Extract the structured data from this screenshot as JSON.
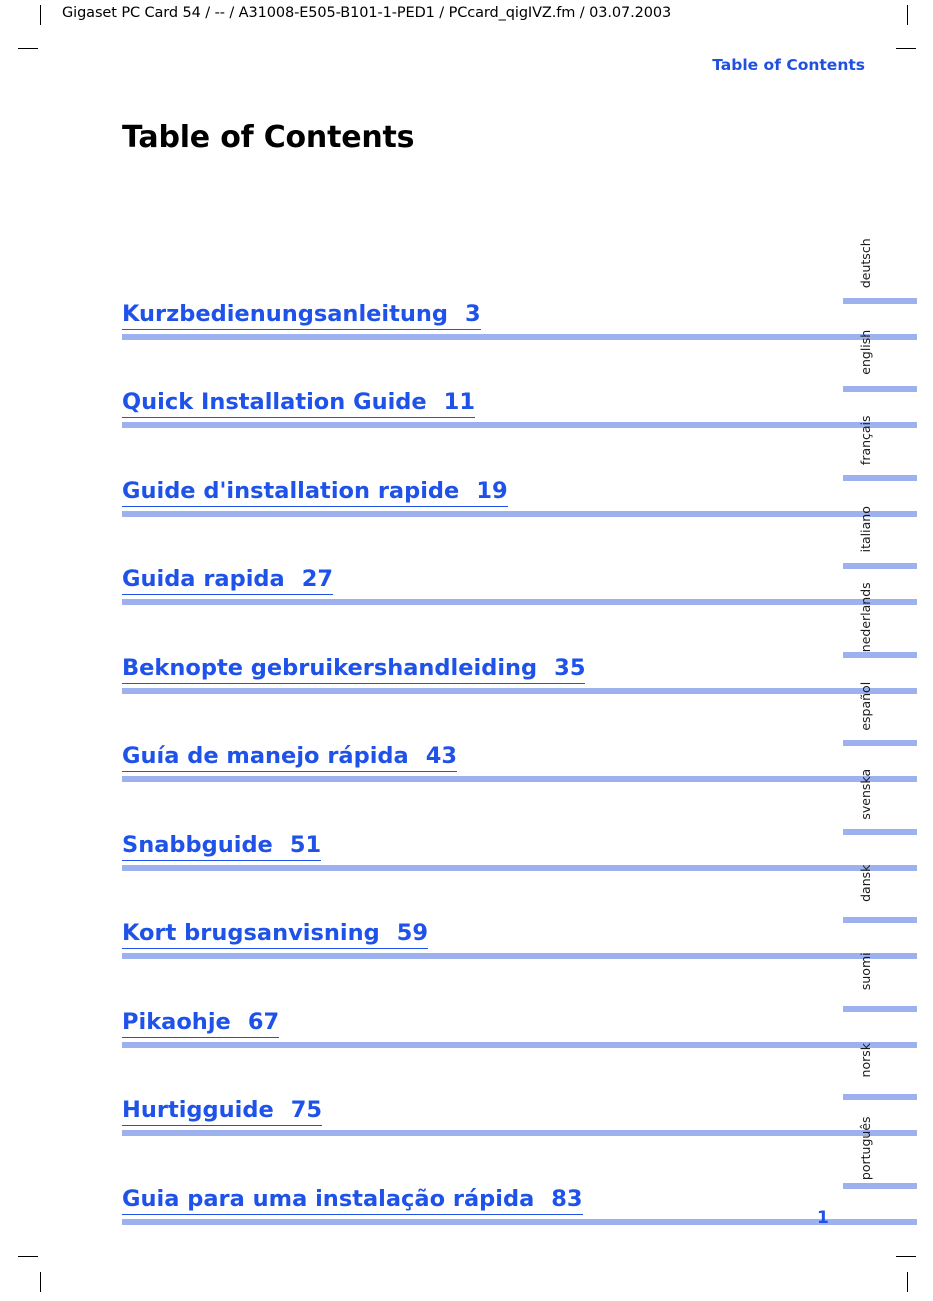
{
  "header": {
    "document_info": "Gigaset PC Card 54 / -- / A31008-E505-B101-1-PED1 / PCcard_qigIVZ.fm / 03.07.2003",
    "section_title": "Table of Contents"
  },
  "page": {
    "title": "Table of Contents",
    "folio": "1",
    "accent_color": "#1f52e8",
    "rule_color": "#9db1ee"
  },
  "toc": {
    "entries": [
      {
        "title": "Kurzbedienungsanleitung",
        "page": "3"
      },
      {
        "title": "Quick Installation Guide",
        "page": "11"
      },
      {
        "title": "Guide d'installation rapide",
        "page": "19"
      },
      {
        "title": "Guida rapida",
        "page": "27"
      },
      {
        "title": "Beknopte gebruikershandleiding",
        "page": "35"
      },
      {
        "title": "Guía de manejo rápida",
        "page": "43"
      },
      {
        "title": "Snabbguide",
        "page": "51"
      },
      {
        "title": "Kort brugsanvisning",
        "page": "59"
      },
      {
        "title": "Pikaohje",
        "page": "67"
      },
      {
        "title": "Hurtigguide",
        "page": "75"
      },
      {
        "title": "Guia para uma instalação rápida",
        "page": "83"
      }
    ]
  },
  "language_tabs": {
    "items": [
      {
        "label": "deutsch"
      },
      {
        "label": "english"
      },
      {
        "label": "français"
      },
      {
        "label": "italiano"
      },
      {
        "label": "nederlands"
      },
      {
        "label": "español"
      },
      {
        "label": "svenska"
      },
      {
        "label": "dansk"
      },
      {
        "label": "suomi"
      },
      {
        "label": "norsk"
      },
      {
        "label": "português"
      }
    ]
  }
}
